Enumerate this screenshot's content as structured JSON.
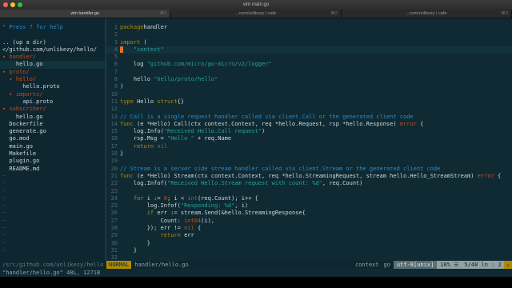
{
  "window": {
    "title": "vim main.go"
  },
  "tabs": [
    {
      "label": "vim handler.go",
      "key": "⌘1",
      "active": true
    },
    {
      "label": "...com/unlikezy | cafe",
      "key": "⌘2",
      "active": false
    },
    {
      "label": "...com/unlikezy | cafe",
      "key": "⌘3",
      "active": false
    }
  ],
  "tree": {
    "lines": [
      {
        "text": "\" Press ? for help",
        "cls": "help"
      },
      {
        "text": "",
        "cls": ""
      },
      {
        "text": ".. (up a dir)",
        "cls": ""
      },
      {
        "text": "</github.com/unlikezy/hello/",
        "cls": ""
      },
      {
        "text": "▾ handler/",
        "cls": "dir"
      },
      {
        "text": "    hello.go",
        "cls": "cursorline"
      },
      {
        "text": "▾ proto/",
        "cls": "dir"
      },
      {
        "text": "  ▾ hello/",
        "cls": "dir"
      },
      {
        "text": "      hello.proto",
        "cls": ""
      },
      {
        "text": "  ▾ imports/",
        "cls": "dir"
      },
      {
        "text": "      api.proto",
        "cls": ""
      },
      {
        "text": "▾ subscriber/",
        "cls": "dir"
      },
      {
        "text": "    hello.go",
        "cls": ""
      },
      {
        "text": "  Dockerfile",
        "cls": ""
      },
      {
        "text": "  generate.go",
        "cls": ""
      },
      {
        "text": "  go.mod",
        "cls": ""
      },
      {
        "text": "  main.go",
        "cls": ""
      },
      {
        "text": "  Makefile",
        "cls": ""
      },
      {
        "text": "  plugin.go",
        "cls": ""
      },
      {
        "text": "  README.md",
        "cls": ""
      },
      {
        "text": "~",
        "cls": "tilde"
      },
      {
        "text": "~",
        "cls": "tilde"
      },
      {
        "text": "~",
        "cls": "tilde"
      },
      {
        "text": "~",
        "cls": "tilde"
      },
      {
        "text": "~",
        "cls": "tilde"
      },
      {
        "text": "~",
        "cls": "tilde"
      },
      {
        "text": "~",
        "cls": "tilde"
      },
      {
        "text": "~",
        "cls": "tilde"
      },
      {
        "text": "~",
        "cls": "tilde"
      },
      {
        "text": "~",
        "cls": "tilde"
      },
      {
        "text": "~",
        "cls": "tilde"
      }
    ]
  },
  "code": {
    "lines": [
      {
        "n": "1",
        "segs": [
          [
            "kw",
            "package"
          ],
          [
            "",
            "handler"
          ]
        ]
      },
      {
        "n": "2",
        "segs": []
      },
      {
        "n": "3",
        "segs": [
          [
            "kw",
            "import"
          ],
          [
            "",
            " ("
          ]
        ]
      },
      {
        "n": "4",
        "segs": [
          [
            "cur",
            " "
          ],
          [
            "str",
            "   \"context\""
          ]
        ]
      },
      {
        "n": "5",
        "segs": []
      },
      {
        "n": "6",
        "segs": [
          [
            "",
            "    log "
          ],
          [
            "str",
            "\"github.com/micro/go-micro/v2/logger\""
          ]
        ]
      },
      {
        "n": "7",
        "segs": []
      },
      {
        "n": "8",
        "segs": [
          [
            "",
            "    hello "
          ],
          [
            "str",
            "\"hello/proto/hello\""
          ]
        ]
      },
      {
        "n": "9",
        "segs": [
          [
            "",
            ")"
          ]
        ]
      },
      {
        "n": "10",
        "segs": []
      },
      {
        "n": "11",
        "segs": [
          [
            "kw",
            "type"
          ],
          [
            "",
            " Hello "
          ],
          [
            "kw",
            "struct"
          ],
          [
            "",
            "{}"
          ]
        ]
      },
      {
        "n": "12",
        "segs": []
      },
      {
        "n": "13",
        "segs": [
          [
            "cm",
            "// Call is a single request handler called via client.Call or the generated client code"
          ]
        ]
      },
      {
        "n": "14",
        "segs": [
          [
            "kw",
            "func"
          ],
          [
            "",
            " (e *Hello) Call(ctx context.Context, req *hello.Request, rsp *hello.Response) "
          ],
          [
            "ty",
            "error"
          ],
          [
            "",
            " {"
          ]
        ]
      },
      {
        "n": "15",
        "segs": [
          [
            "",
            "    log.Info("
          ],
          [
            "str",
            "\"Received Hello.Call request\""
          ],
          [
            "",
            ")"
          ]
        ]
      },
      {
        "n": "16",
        "segs": [
          [
            "",
            "    rsp.Msg = "
          ],
          [
            "str",
            "\"Hello \""
          ],
          [
            "",
            " + req.Name"
          ]
        ]
      },
      {
        "n": "17",
        "segs": [
          [
            "kw",
            "    return"
          ],
          [
            "",
            " "
          ],
          [
            "ty",
            "nil"
          ]
        ]
      },
      {
        "n": "18",
        "segs": [
          [
            "",
            "}"
          ]
        ]
      },
      {
        "n": "19",
        "segs": []
      },
      {
        "n": "20",
        "segs": [
          [
            "cm",
            "// Stream is a server side stream handler called via client.Stream or the generated client code"
          ]
        ]
      },
      {
        "n": "21",
        "segs": [
          [
            "kw",
            "func"
          ],
          [
            "",
            " (e *Hello) Stream(ctx context.Context, req *hello.StreamingRequest, stream hello.Hello_StreamStream) "
          ],
          [
            "ty",
            "error"
          ],
          [
            "",
            " {"
          ]
        ]
      },
      {
        "n": "22",
        "segs": [
          [
            "",
            "    log.Infof("
          ],
          [
            "str",
            "\"Received Hello.Stream request with count: %d\""
          ],
          [
            "",
            ", req.Count)"
          ]
        ]
      },
      {
        "n": "23",
        "segs": []
      },
      {
        "n": "24",
        "segs": [
          [
            "kw",
            "    for"
          ],
          [
            "",
            " i := "
          ],
          [
            "ty",
            "0"
          ],
          [
            "",
            "; i < "
          ],
          [
            "ty",
            "int"
          ],
          [
            "",
            "(req.Count); i++ {"
          ]
        ]
      },
      {
        "n": "25",
        "segs": [
          [
            "",
            "        log.Infof("
          ],
          [
            "str",
            "\"Responding: %d\""
          ],
          [
            "",
            ", i)"
          ]
        ]
      },
      {
        "n": "26",
        "segs": [
          [
            "kw",
            "        if"
          ],
          [
            "",
            " err := stream.Send(&hello.StreamingResponse{"
          ]
        ]
      },
      {
        "n": "27",
        "segs": [
          [
            "",
            "            Count: "
          ],
          [
            "ty",
            "int64"
          ],
          [
            "",
            "(i),"
          ]
        ]
      },
      {
        "n": "28",
        "segs": [
          [
            "",
            "        }); err != "
          ],
          [
            "ty",
            "nil"
          ],
          [
            "",
            " {"
          ]
        ]
      },
      {
        "n": "29",
        "segs": [
          [
            "kw",
            "            return"
          ],
          [
            "",
            " err"
          ]
        ]
      },
      {
        "n": "30",
        "segs": [
          [
            "",
            "        }"
          ]
        ]
      },
      {
        "n": "31",
        "segs": [
          [
            "",
            "    }"
          ]
        ]
      },
      {
        "n": "32",
        "segs": []
      },
      {
        "n": "33",
        "segs": [
          [
            "kw",
            "    return"
          ],
          [
            "",
            " "
          ],
          [
            "ty",
            "nil"
          ]
        ]
      }
    ]
  },
  "statusline": {
    "tree_path": "/src/github.com/unlikezy/hello",
    "mode": "NORMAL",
    "file": "handler/hello.go",
    "function": "context",
    "filetype": "go",
    "encoding": "utf-8[unix]",
    "percent": "10% ☰",
    "position": "5/48 ln : 2",
    "warn": "⚠"
  },
  "cmdline": {
    "text": "\"handler/hello.go\" 48L, 1271B"
  }
}
